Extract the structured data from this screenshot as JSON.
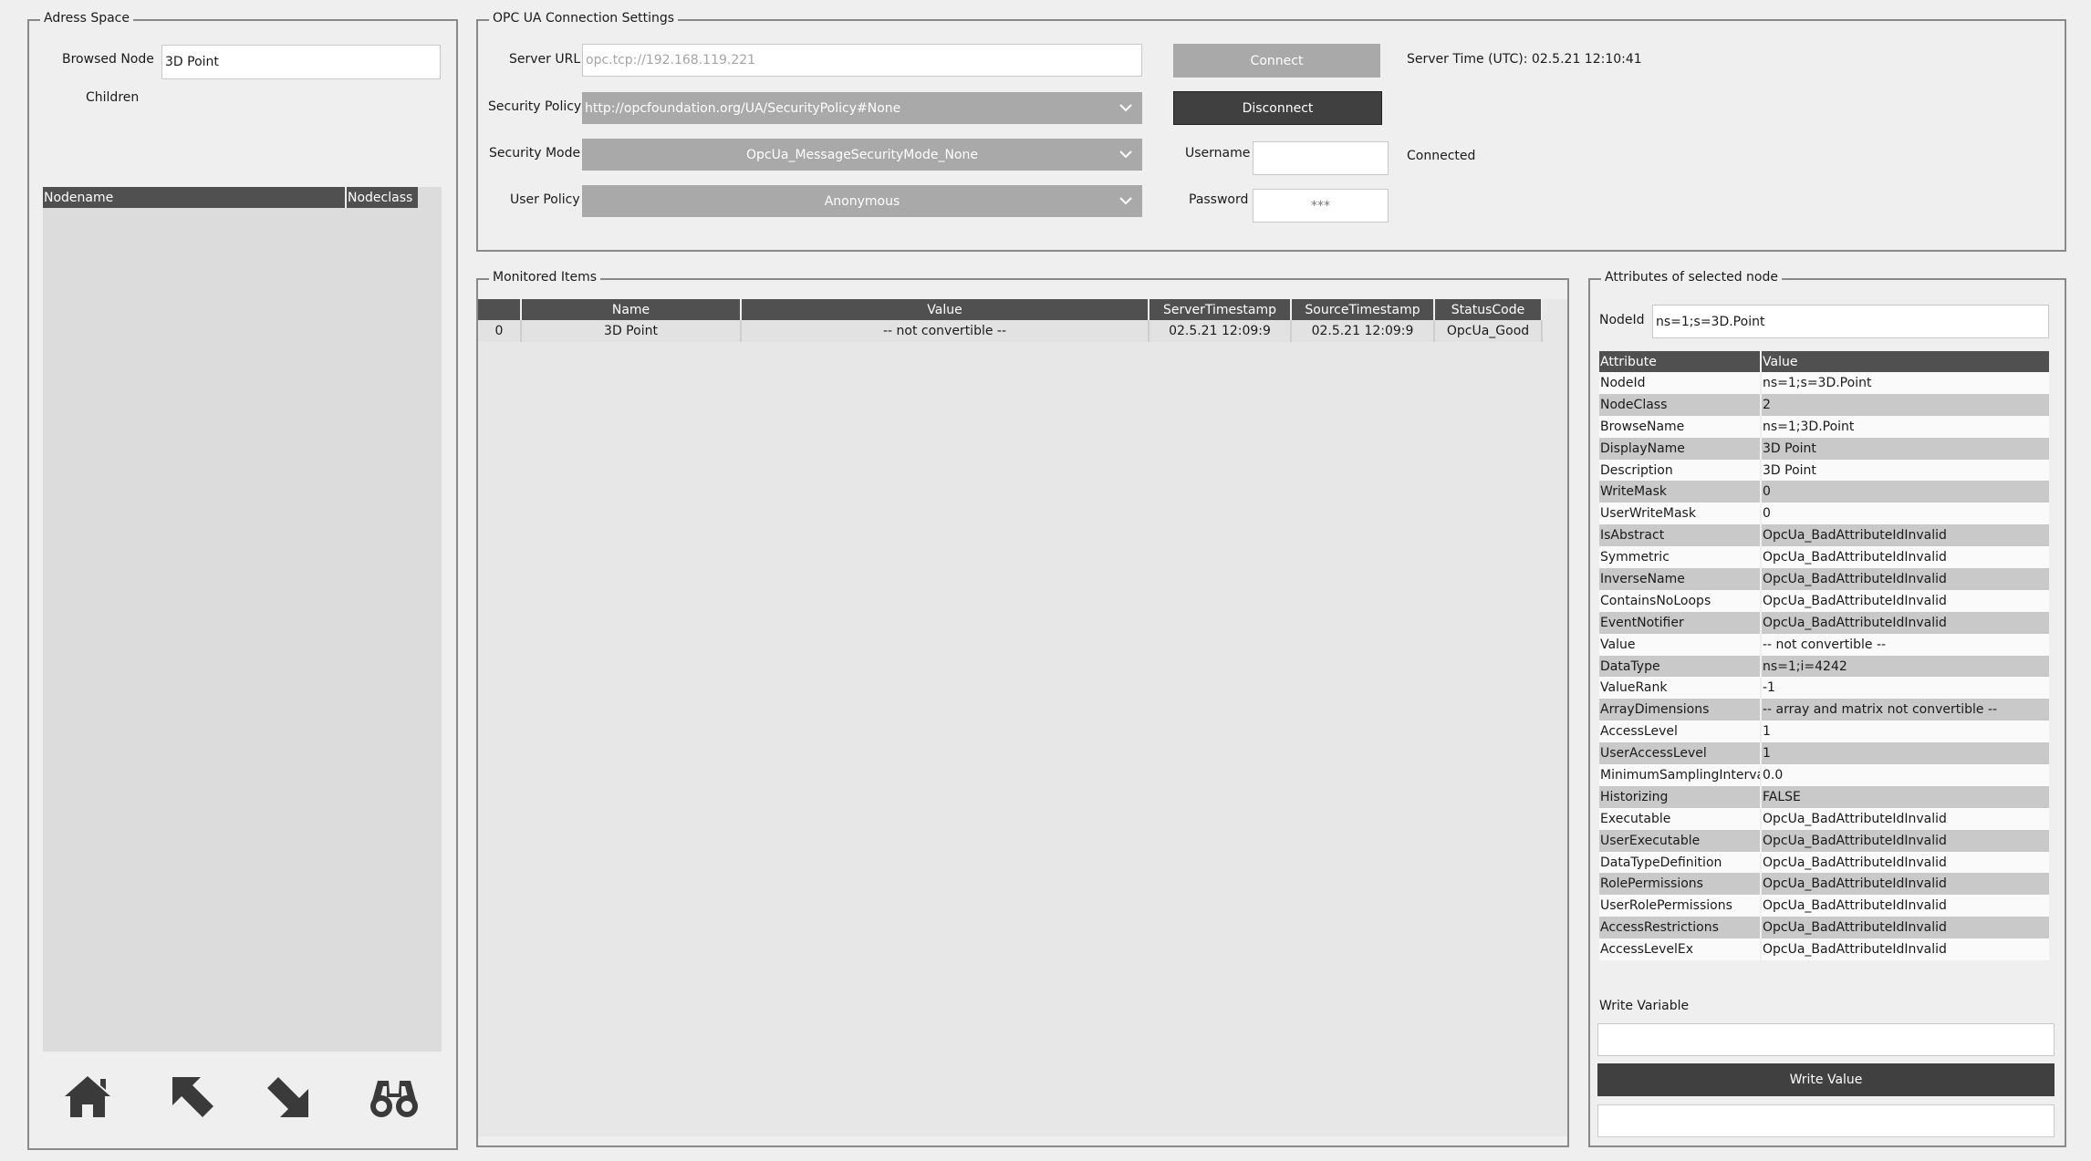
{
  "address_space": {
    "legend": "Adress Space",
    "browsed_node_label": "Browsed Node",
    "browsed_node_value": "3D Point",
    "children_label": "Children",
    "columns": [
      "Nodename",
      "Nodeclass"
    ],
    "nav_icons": [
      "home-icon",
      "arrow-up-left-icon",
      "arrow-down-right-icon",
      "binoculars-icon"
    ]
  },
  "connection": {
    "legend": "OPC UA Connection Settings",
    "server_url_label": "Server URL",
    "server_url_placeholder": "opc.tcp://192.168.119.221",
    "security_policy_label": "Security Policy",
    "security_policy_value": "http://opcfoundation.org/UA/SecurityPolicy#None",
    "security_mode_label": "Security Mode",
    "security_mode_value": "OpcUa_MessageSecurityMode_None",
    "user_policy_label": "User Policy",
    "user_policy_value": "Anonymous",
    "connect_label": "Connect",
    "disconnect_label": "Disconnect",
    "username_label": "Username",
    "password_label": "Password",
    "password_value": "***",
    "server_time": "Server Time (UTC): 02.5.21 12:10:41",
    "status": "Connected"
  },
  "monitored": {
    "legend": "Monitored Items",
    "columns": [
      "",
      "Name",
      "Value",
      "ServerTimestamp",
      "SourceTimestamp",
      "StatusCode"
    ],
    "rows": [
      [
        "0",
        "3D Point",
        "-- not convertible --",
        "02.5.21 12:09:9",
        "02.5.21 12:09:9",
        "OpcUa_Good"
      ]
    ]
  },
  "attributes": {
    "legend": "Attributes of selected node",
    "nodeid_label": "NodeId",
    "nodeid_value": "ns=1;s=3D.Point",
    "header": [
      "Attribute",
      "Value"
    ],
    "rows": [
      [
        "NodeId",
        "ns=1;s=3D.Point"
      ],
      [
        "NodeClass",
        "2"
      ],
      [
        "BrowseName",
        "ns=1;3D.Point"
      ],
      [
        "DisplayName",
        "3D Point"
      ],
      [
        "Description",
        "3D Point"
      ],
      [
        "WriteMask",
        "0"
      ],
      [
        "UserWriteMask",
        "0"
      ],
      [
        "IsAbstract",
        "OpcUa_BadAttributeIdInvalid"
      ],
      [
        "Symmetric",
        "OpcUa_BadAttributeIdInvalid"
      ],
      [
        "InverseName",
        "OpcUa_BadAttributeIdInvalid"
      ],
      [
        "ContainsNoLoops",
        "OpcUa_BadAttributeIdInvalid"
      ],
      [
        "EventNotifier",
        "OpcUa_BadAttributeIdInvalid"
      ],
      [
        "Value",
        "-- not convertible --"
      ],
      [
        "DataType",
        "ns=1;i=4242"
      ],
      [
        "ValueRank",
        "-1"
      ],
      [
        "ArrayDimensions",
        " -- array and matrix not convertible --"
      ],
      [
        "AccessLevel",
        "1"
      ],
      [
        "UserAccessLevel",
        "1"
      ],
      [
        "MinimumSamplingInterval",
        "0.0"
      ],
      [
        "Historizing",
        "FALSE"
      ],
      [
        "Executable",
        "OpcUa_BadAttributeIdInvalid"
      ],
      [
        "UserExecutable",
        "OpcUa_BadAttributeIdInvalid"
      ],
      [
        "DataTypeDefinition",
        "OpcUa_BadAttributeIdInvalid"
      ],
      [
        "RolePermissions",
        "OpcUa_BadAttributeIdInvalid"
      ],
      [
        "UserRolePermissions",
        "OpcUa_BadAttributeIdInvalid"
      ],
      [
        "AccessRestrictions",
        "OpcUa_BadAttributeIdInvalid"
      ],
      [
        "AccessLevelEx",
        "OpcUa_BadAttributeIdInvalid"
      ]
    ],
    "write_variable_label": "Write Variable",
    "write_value_button": "Write Value"
  }
}
